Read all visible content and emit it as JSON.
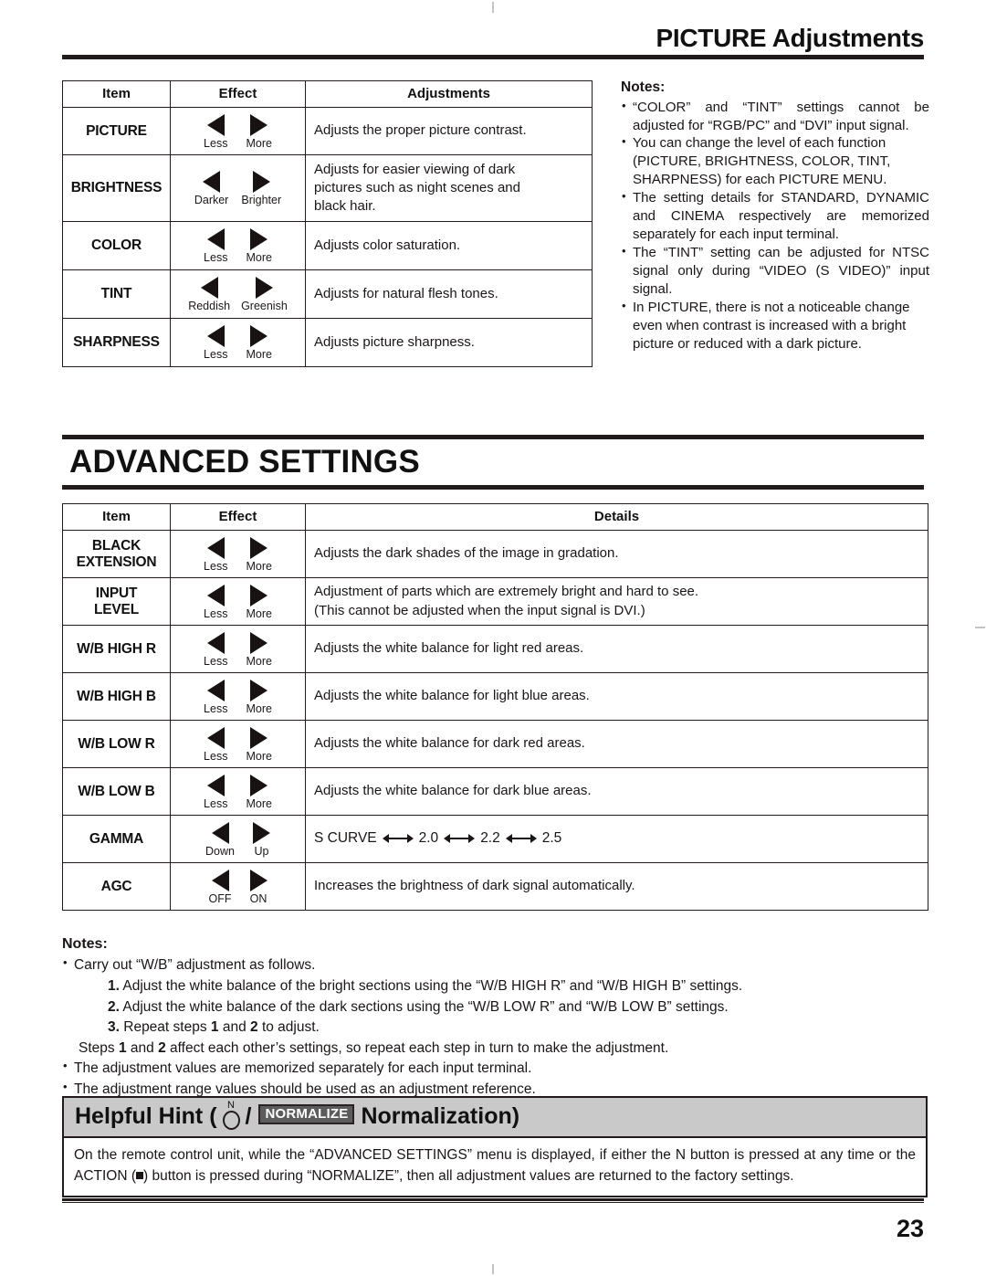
{
  "header": {
    "title": "PICTURE Adjustments"
  },
  "picture_table": {
    "columns": [
      "Item",
      "Effect",
      "Adjustments"
    ],
    "rows": [
      {
        "item": "PICTURE",
        "left_label": "Less",
        "right_label": "More",
        "description": [
          "Adjusts the proper picture contrast."
        ],
        "justify": false
      },
      {
        "item": "BRIGHTNESS",
        "left_label": "Darker",
        "right_label": "Brighter",
        "description": [
          "Adjusts for easier viewing of dark",
          "pictures such as night scenes and",
          "black hair."
        ],
        "justify": true
      },
      {
        "item": "COLOR",
        "left_label": "Less",
        "right_label": "More",
        "description": [
          "Adjusts color saturation."
        ],
        "justify": false
      },
      {
        "item": "TINT",
        "left_label": "Reddish",
        "right_label": "Greenish",
        "description": [
          "Adjusts for natural flesh tones."
        ],
        "justify": false
      },
      {
        "item": "SHARPNESS",
        "left_label": "Less",
        "right_label": "More",
        "description": [
          "Adjusts picture sharpness."
        ],
        "justify": false
      }
    ]
  },
  "picture_notes": {
    "title": "Notes:",
    "items": [
      "“COLOR” and “TINT” settings cannot be adjusted for “RGB/PC” and “DVI” input signal.",
      "You can change the level of each function (PICTURE, BRIGHTNESS, COLOR, TINT, SHARPNESS) for each PICTURE MENU.",
      "The setting details for STANDARD, DYNAMIC and CINEMA respectively are memorized separately for each input terminal.",
      "The “TINT” setting can be adjusted for NTSC signal only during “VIDEO (S VIDEO)” input signal.",
      "In PICTURE, there is not a noticeable change even when contrast is increased with a bright picture or reduced with a dark picture."
    ]
  },
  "advanced": {
    "heading": "ADVANCED SETTINGS",
    "columns": [
      "Item",
      "Effect",
      "Details"
    ],
    "rows": [
      {
        "item": "BLACK\nEXTENSION",
        "item_lines": [
          "BLACK",
          "EXTENSION"
        ],
        "left_label": "Less",
        "right_label": "More",
        "description": [
          "Adjusts the dark shades of the image in gradation."
        ]
      },
      {
        "item": "INPUT LEVEL",
        "item_lines": [
          "INPUT",
          "LEVEL"
        ],
        "left_label": "Less",
        "right_label": "More",
        "description": [
          "Adjustment of parts which are extremely bright and hard to see.",
          "(This cannot be adjusted when the input signal is DVI.)"
        ]
      },
      {
        "item": "W/B HIGH R",
        "item_lines": [
          "W/B HIGH R"
        ],
        "left_label": "Less",
        "right_label": "More",
        "description": [
          "Adjusts the white balance for light red areas."
        ]
      },
      {
        "item": "W/B HIGH B",
        "item_lines": [
          "W/B HIGH B"
        ],
        "left_label": "Less",
        "right_label": "More",
        "description": [
          "Adjusts the white balance for light blue areas."
        ]
      },
      {
        "item": "W/B LOW R",
        "item_lines": [
          "W/B LOW R"
        ],
        "left_label": "Less",
        "right_label": "More",
        "description": [
          "Adjusts the white balance for dark red areas."
        ]
      },
      {
        "item": "W/B LOW B",
        "item_lines": [
          "W/B LOW B"
        ],
        "left_label": "Less",
        "right_label": "More",
        "description": [
          "Adjusts the white balance for dark blue areas."
        ]
      },
      {
        "item": "GAMMA",
        "item_lines": [
          "GAMMA"
        ],
        "left_label": "Down",
        "right_label": "Up",
        "gamma_sequence": [
          "S CURVE",
          "2.0",
          "2.2",
          "2.5"
        ],
        "description": []
      },
      {
        "item": "AGC",
        "item_lines": [
          "AGC"
        ],
        "left_label": "OFF",
        "right_label": "ON",
        "description": [
          "Increases the brightness of dark signal automatically."
        ]
      }
    ]
  },
  "advanced_notes": {
    "title": "Notes:",
    "bullet1": "Carry out “W/B” adjustment as follows.",
    "steps": [
      {
        "num": "1.",
        "text": "Adjust the white balance of the bright sections using the “W/B HIGH R” and “W/B HIGH B” settings."
      },
      {
        "num": "2.",
        "text": "Adjust the white balance of the dark sections using the “W/B LOW R” and “W/B LOW B” settings."
      },
      {
        "num": "3.",
        "text_pre": "Repeat steps ",
        "bold_a": "1",
        "text_mid": " and ",
        "bold_b": "2",
        "text_post": " to adjust."
      }
    ],
    "summary": {
      "pre": "Steps ",
      "bold_a": "1",
      "mid": " and ",
      "bold_b": "2",
      "post": " affect each other’s settings, so repeat each step in turn to make the adjustment."
    },
    "bullet2": "The adjustment values are memorized separately for each input terminal.",
    "bullet3": "The adjustment range values should be used as an adjustment reference."
  },
  "hint": {
    "prefix": "Helpful Hint (",
    "n_label": "N",
    "slash": "/",
    "badge": "NORMALIZE",
    "suffix": "Normalization)",
    "body_pre": "On the remote control unit, while the “ADVANCED SETTINGS” menu is displayed, if either the N button is pressed at any time or the ACTION (",
    "body_post": ") button is pressed during “NORMALIZE”, then all adjustment values are returned to the factory settings."
  },
  "footer": {
    "page_number": "23"
  },
  "colors": {
    "ink": "#1b1515",
    "rule": "#231b1b",
    "hint_header_bg": "#c9c9c9",
    "badge_bg": "#5c5c5c",
    "badge_fg": "#ffffff"
  }
}
